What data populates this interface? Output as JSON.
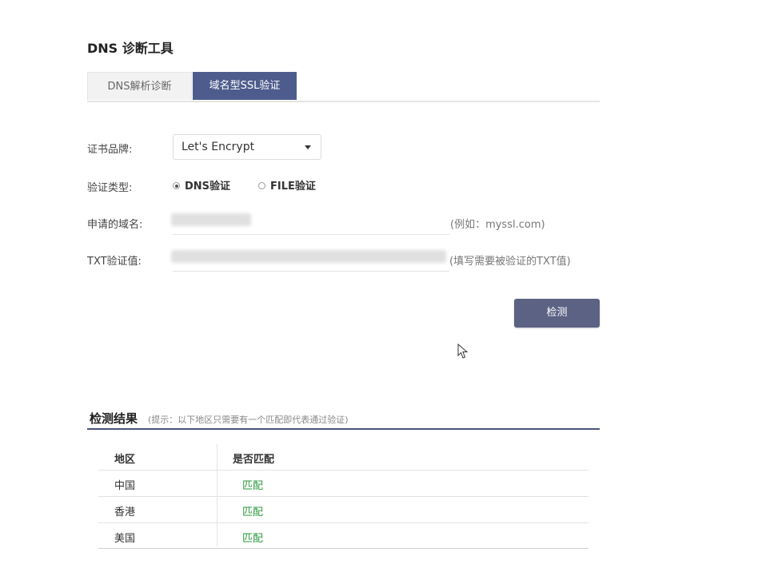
{
  "page": {
    "title": "DNS 诊断工具"
  },
  "tabs": [
    {
      "label": "DNS解析诊断",
      "active": false
    },
    {
      "label": "域名型SSL验证",
      "active": true
    }
  ],
  "form": {
    "brand_label": "证书品牌:",
    "brand_value": "Let's Encrypt",
    "type_label": "验证类型:",
    "type_options": [
      {
        "label": "DNS验证",
        "checked": true
      },
      {
        "label": "FILE验证",
        "checked": false
      }
    ],
    "domain_label": "申请的域名:",
    "domain_hint": "(例如：myssl.com)",
    "txt_label": "TXT验证值:",
    "txt_hint": "(填写需要被验证的TXT值)",
    "check_button": "检测"
  },
  "results": {
    "title": "检测结果",
    "hint": "(提示：以下地区只需要有一个匹配即代表通过验证)",
    "columns": [
      "地区",
      "是否匹配"
    ],
    "rows": [
      {
        "region": "中国",
        "match": "匹配"
      },
      {
        "region": "香港",
        "match": "匹配"
      },
      {
        "region": "美国",
        "match": "匹配"
      }
    ]
  },
  "colors": {
    "accent": "#4e5c8d",
    "button": "#5b6283",
    "match": "#2a9a3e"
  }
}
